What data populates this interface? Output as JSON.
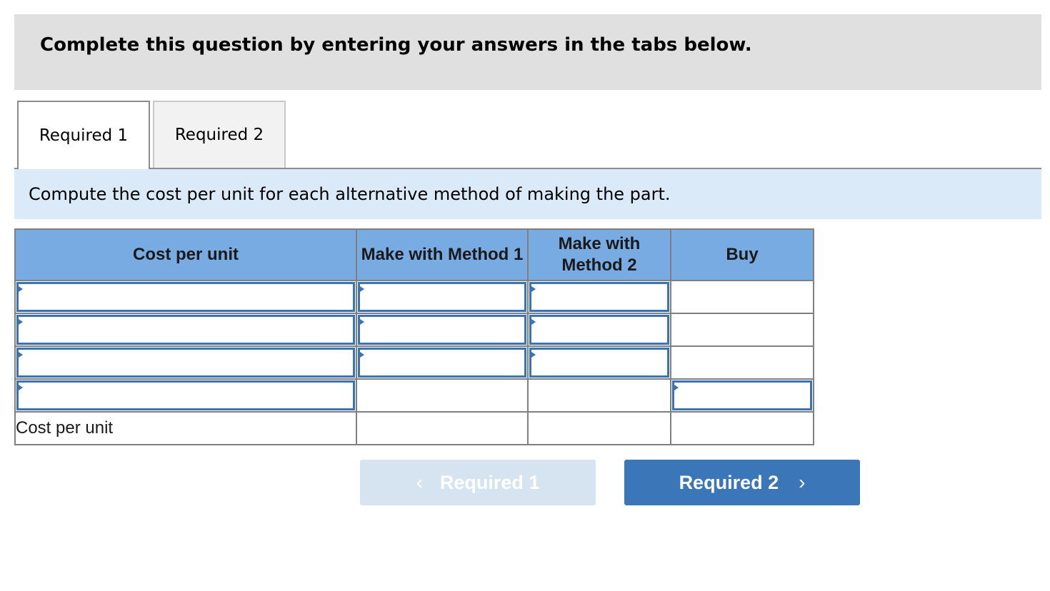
{
  "banner": {
    "text": "Complete this question by entering your answers in the tabs below."
  },
  "tabs": [
    {
      "label": "Required 1",
      "active": true
    },
    {
      "label": "Required 2",
      "active": false
    }
  ],
  "instruction": "Compute the cost per unit for each alternative method of making the part.",
  "table": {
    "headers": [
      "Cost per unit",
      "Make with Method 1",
      "Make with Method 2",
      "Buy"
    ],
    "rows": [
      {
        "label": "",
        "method1": "",
        "method2": "",
        "buy": ""
      },
      {
        "label": "",
        "method1": "",
        "method2": "",
        "buy": ""
      },
      {
        "label": "",
        "method1": "",
        "method2": "",
        "buy": ""
      },
      {
        "label": "",
        "method1": "",
        "method2": "",
        "buy": ""
      }
    ],
    "total": {
      "label": "Cost per unit",
      "method1": "",
      "method2": "",
      "buy": ""
    }
  },
  "nav": {
    "prev_label": "Required 1",
    "next_label": "Required 2",
    "prev_icon": "chevron-left-icon",
    "next_icon": "chevron-right-icon"
  },
  "colors": {
    "header_bg": "#77abe2",
    "input_border": "#3b73b5",
    "instruction_bg": "#dbeaf8",
    "next_button": "#3a76b8",
    "prev_button_disabled": "#d6e3f1"
  }
}
